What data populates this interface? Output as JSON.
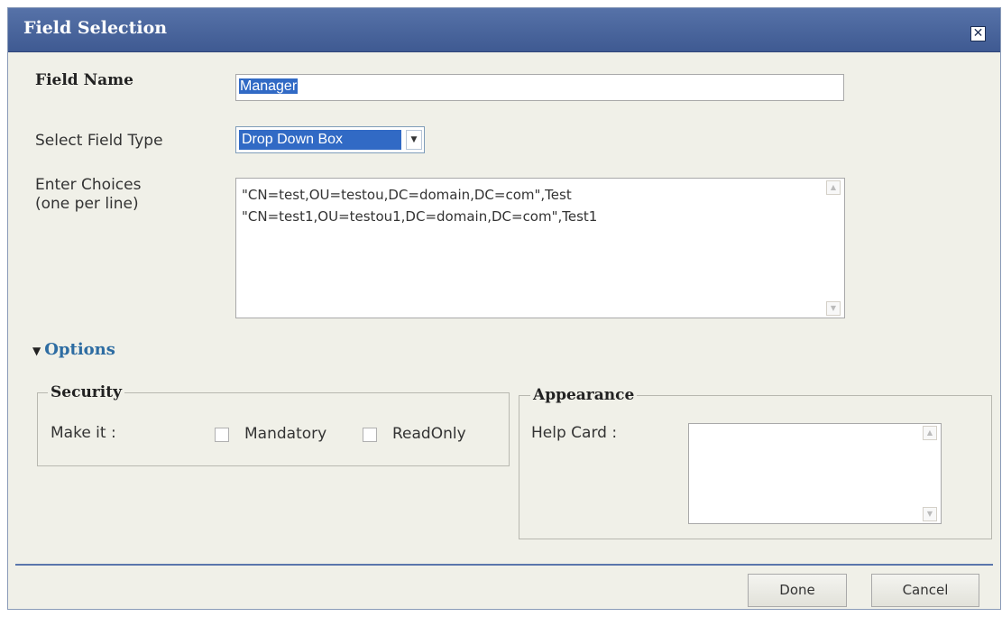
{
  "dialog": {
    "title": "Field Selection",
    "close_icon": "close-icon"
  },
  "form": {
    "field_name_label": "Field Name",
    "field_name_value": "Manager",
    "field_type_label": "Select Field Type",
    "field_type_value": "Drop Down Box",
    "choices_label_line1": "Enter Choices",
    "choices_label_line2": "(one per line)",
    "choices_value": "\"CN=test,OU=testou,DC=domain,DC=com\",Test\n\"CN=test1,OU=testou1,DC=domain,DC=com\",Test1"
  },
  "options": {
    "toggle_label": "Options",
    "expanded": true,
    "security": {
      "legend": "Security",
      "make_it_label": "Make it :",
      "mandatory_label": "Mandatory",
      "mandatory_checked": false,
      "readonly_label": "ReadOnly",
      "readonly_checked": false
    },
    "appearance": {
      "legend": "Appearance",
      "help_card_label": "Help Card :",
      "help_card_value": ""
    }
  },
  "footer": {
    "done_label": "Done",
    "cancel_label": "Cancel"
  },
  "colors": {
    "titlebar": "#4a66a0",
    "dialog_bg": "#f0f0e8",
    "options_link": "#2d6ca2",
    "selection_highlight": "#316ac5"
  }
}
